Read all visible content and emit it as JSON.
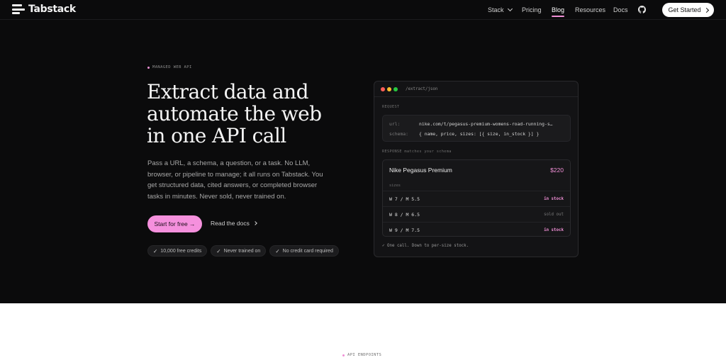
{
  "nav": {
    "brand": "Tabstack",
    "links": [
      {
        "label": "Stack",
        "has_dropdown": true
      },
      {
        "label": "Pricing"
      },
      {
        "label": "Blog",
        "active": true
      },
      {
        "label": "Resources"
      },
      {
        "label": "Docs"
      }
    ],
    "github_icon": "github-icon",
    "cta_label": "Get Started"
  },
  "hero": {
    "eyebrow": "MANAGED WEB API",
    "headline_lines": [
      "Extract data and",
      "automate the web",
      "in one API call"
    ],
    "body": "Pass a URL, a schema, a question, or a task. No LLM, browser, or pipeline to manage; it all runs on Tabstack. You get structured data, cited answers, or completed browser tasks in minutes. Never sold, never trained on.",
    "primary_cta": "Start for free →",
    "secondary_cta": "Read the docs",
    "pills": [
      {
        "check": "✓",
        "label": "10,000 free credits"
      },
      {
        "check": "✓",
        "label": "Never trained on"
      },
      {
        "check": "✓",
        "label": "No credit card required"
      }
    ]
  },
  "card": {
    "path": "/extract/json",
    "request_label": "REQUEST",
    "request": {
      "url_key": "url:",
      "url_value": "nike.com/t/pegasus-premium-womens-road-running-s…",
      "schema_key": "schema:",
      "schema_value": "{ name, price, sizes: [{ size, in_stock }] }"
    },
    "response_label": "RESPONSE matches your schema",
    "response": {
      "name": "Nike Pegasus Premium",
      "price": "$220",
      "sizes_label": "sizes",
      "sizes": [
        {
          "size": "W 7 / M 5.5",
          "status": "in stock",
          "in_stock": true
        },
        {
          "size": "W 8 / M 6.5",
          "status": "sold out",
          "in_stock": false
        },
        {
          "size": "W 9 / M 7.5",
          "status": "in stock",
          "in_stock": true
        }
      ]
    },
    "footnote": "✓ One call. Down to per-size stock."
  },
  "lower": {
    "eyebrow": "API ENDPOINTS"
  },
  "colors": {
    "accent_pink": "#f590dd",
    "background": "#0b0b0c",
    "traffic_red": "#ff5f57",
    "traffic_yellow": "#febc2e",
    "traffic_green": "#28c840"
  }
}
